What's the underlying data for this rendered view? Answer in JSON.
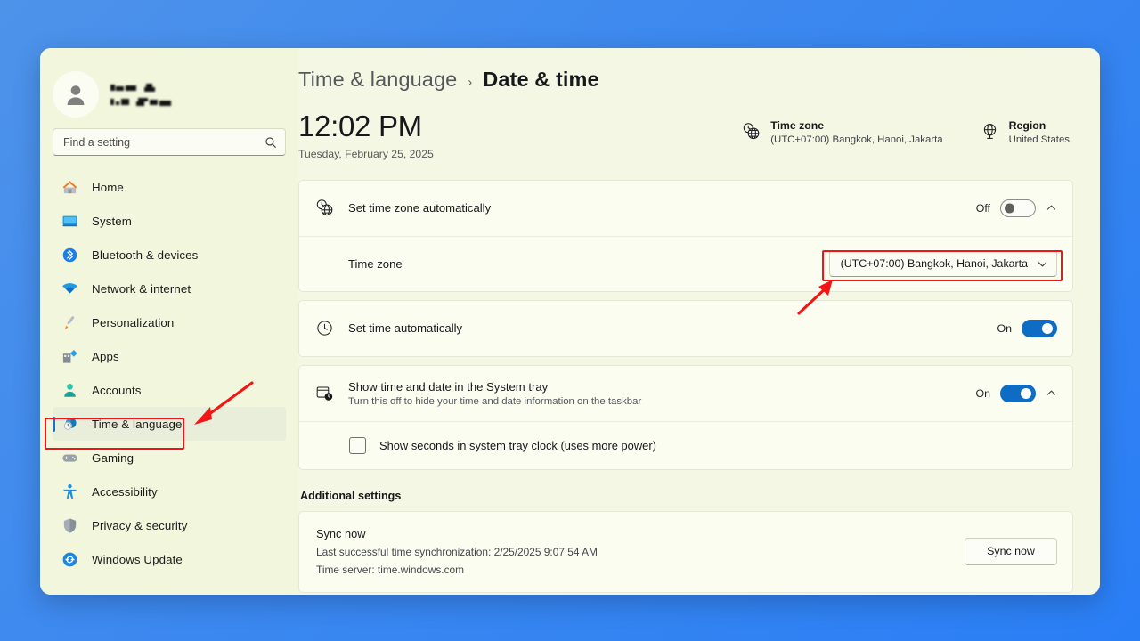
{
  "window": {
    "accent_blue": "#0f6cc4",
    "desktop_gradient_from": "#4e93ea",
    "desktop_gradient_to": "#2a7ef5",
    "annotation_color": "#f51414"
  },
  "sidebar": {
    "profile": {
      "name_redacted": true,
      "avatar_icon": "user-avatar-icon"
    },
    "search": {
      "placeholder": "Find a setting",
      "value": "",
      "icon": "search-icon"
    },
    "items": [
      {
        "label": "Home",
        "icon": "home-icon",
        "selected": false
      },
      {
        "label": "System",
        "icon": "system-icon",
        "selected": false
      },
      {
        "label": "Bluetooth & devices",
        "icon": "bluetooth-icon",
        "selected": false
      },
      {
        "label": "Network & internet",
        "icon": "wifi-icon",
        "selected": false
      },
      {
        "label": "Personalization",
        "icon": "paintbrush-icon",
        "selected": false
      },
      {
        "label": "Apps",
        "icon": "apps-icon",
        "selected": false
      },
      {
        "label": "Accounts",
        "icon": "accounts-icon",
        "selected": false
      },
      {
        "label": "Time & language",
        "icon": "clock-icon",
        "selected": true
      },
      {
        "label": "Gaming",
        "icon": "gamepad-icon",
        "selected": false
      },
      {
        "label": "Accessibility",
        "icon": "accessibility-icon",
        "selected": false
      },
      {
        "label": "Privacy & security",
        "icon": "shield-icon",
        "selected": false
      },
      {
        "label": "Windows Update",
        "icon": "update-icon",
        "selected": false
      }
    ]
  },
  "header": {
    "breadcrumb_parent": "Time & language",
    "breadcrumb_separator": "›",
    "breadcrumb_current": "Date & time",
    "current_time": "12:02 PM",
    "current_date": "Tuesday, February 25, 2025",
    "timezone_card": {
      "icon": "clock-globe-icon",
      "title": "Time zone",
      "value": "(UTC+07:00) Bangkok, Hanoi, Jakarta"
    },
    "region_card": {
      "icon": "globe-icon",
      "title": "Region",
      "value": "United States"
    }
  },
  "settings": {
    "set_timezone_auto": {
      "icon": "clock-globe-icon",
      "title": "Set time zone automatically",
      "state_label": "Off",
      "toggle_on": false,
      "expander_icon": "chevron-up-icon"
    },
    "timezone_row": {
      "title": "Time zone",
      "selected_option": "(UTC+07:00) Bangkok, Hanoi, Jakarta",
      "dropdown_icon": "chevron-down-icon",
      "highlighted": true
    },
    "set_time_auto": {
      "icon": "clock-icon",
      "title": "Set time automatically",
      "state_label": "On",
      "toggle_on": true
    },
    "show_tray": {
      "icon": "calendar-clock-icon",
      "title": "Show time and date in the System tray",
      "subtitle": "Turn this off to hide your time and date information on the taskbar",
      "state_label": "On",
      "toggle_on": true,
      "expander_icon": "chevron-up-icon"
    },
    "show_seconds": {
      "label": "Show seconds in system tray clock (uses more power)",
      "checked": false
    }
  },
  "additional": {
    "section_title": "Additional settings",
    "sync": {
      "title": "Sync now",
      "last_sync": "Last successful time synchronization: 2/25/2025 9:07:54 AM",
      "time_server": "Time server: time.windows.com",
      "button_label": "Sync now"
    }
  }
}
